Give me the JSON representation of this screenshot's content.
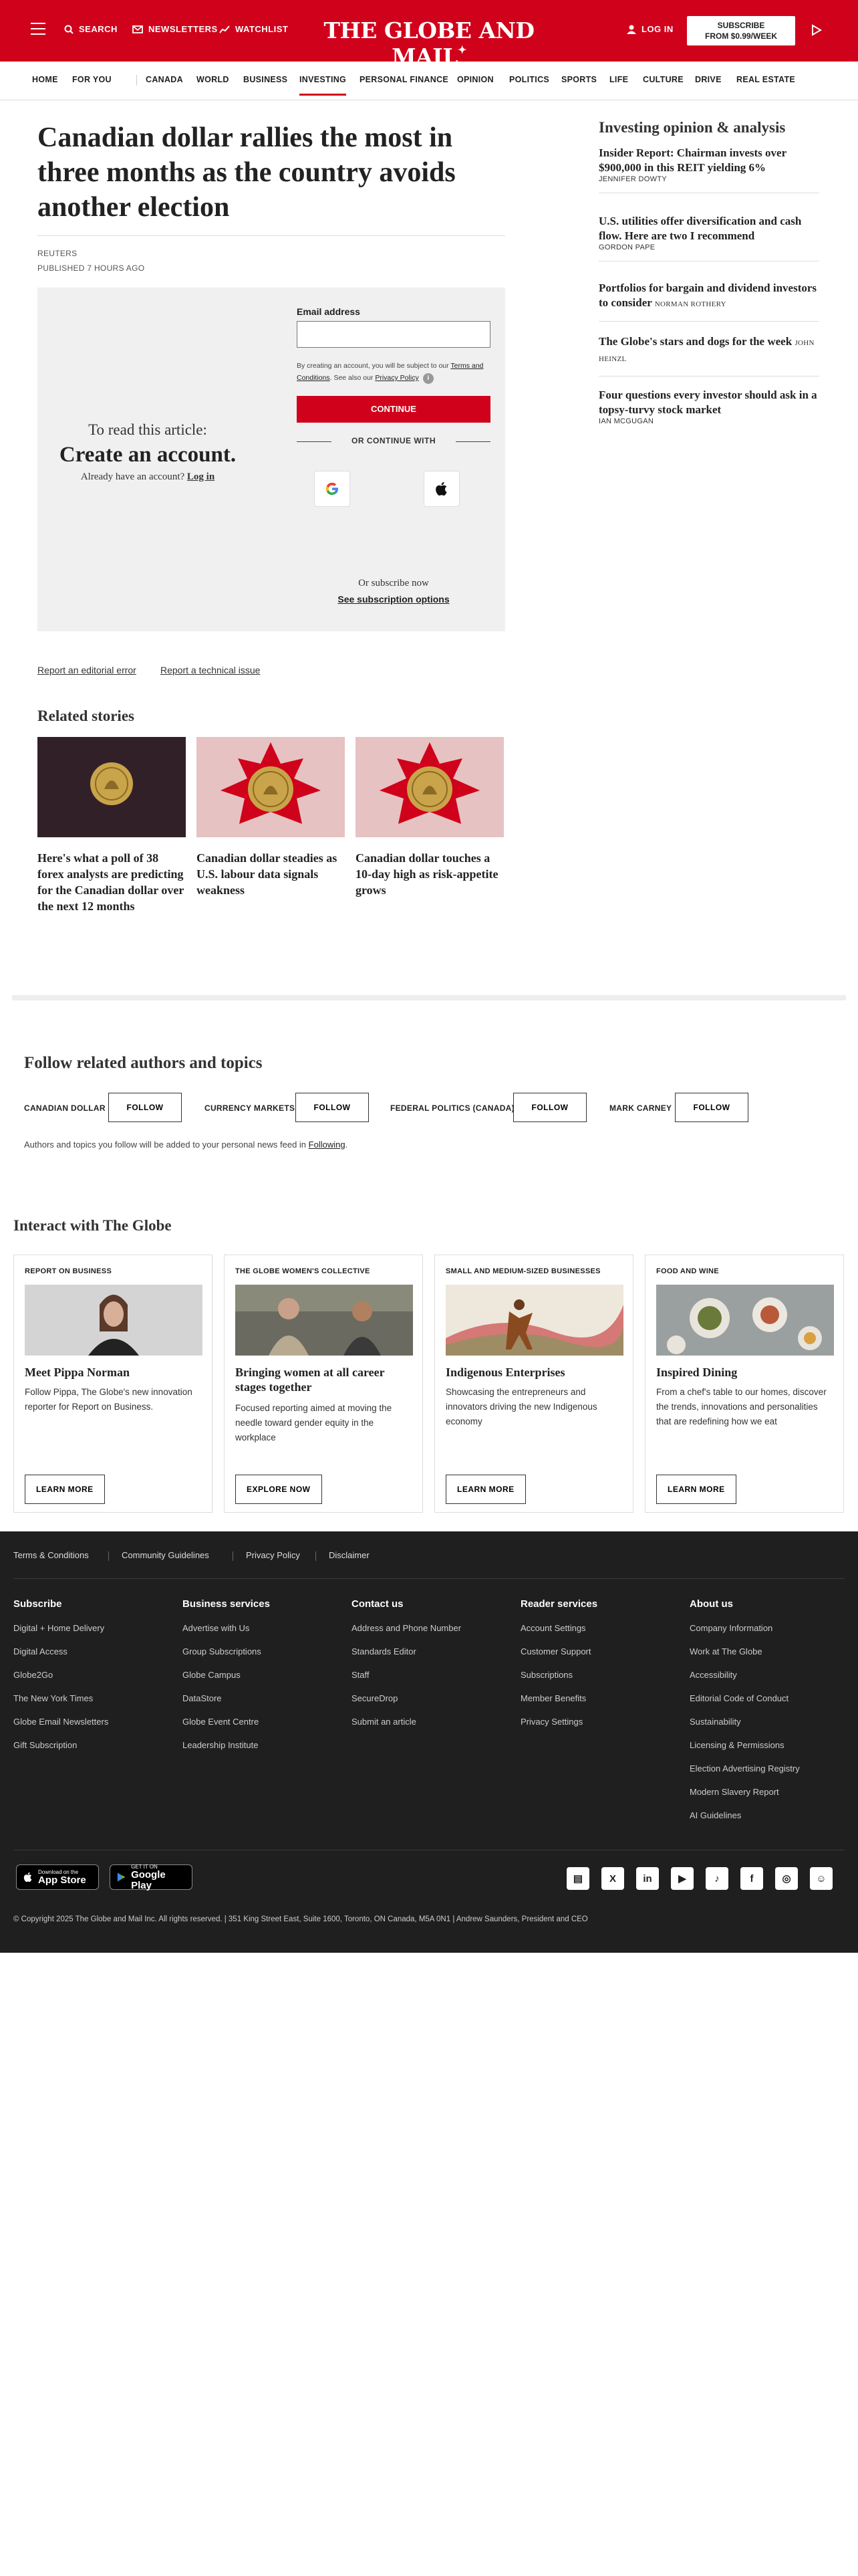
{
  "header": {
    "search_label": "SEARCH",
    "newsletters_label": "NEWSLETTERS",
    "watchlist_label": "WATCHLIST",
    "logo": "THE GLOBE AND MAIL",
    "login_label": "LOG IN",
    "subscribe_line1": "SUBSCRIBE",
    "subscribe_line2": "FROM $0.99/WEEK",
    "brand_color": "#d0021b"
  },
  "nav": {
    "items": [
      "HOME",
      "FOR YOU",
      "CANADA",
      "WORLD",
      "BUSINESS",
      "INVESTING",
      "PERSONAL FINANCE",
      "OPINION",
      "POLITICS",
      "SPORTS",
      "LIFE",
      "CULTURE",
      "DRIVE",
      "REAL ESTATE"
    ],
    "active": "INVESTING"
  },
  "article": {
    "headline": "Canadian dollar rallies the most in three months as the country avoids another election",
    "byline": "REUTERS",
    "published": "PUBLISHED 7 HOURS AGO"
  },
  "paywall": {
    "read_line": "To read this article:",
    "create_account": "Create an account.",
    "already": "Already have an account?",
    "login_link": "Log in",
    "email_label": "Email address",
    "email_value": "",
    "terms_pre": "By creating an account, you will be subject to our ",
    "terms_link": "Terms and Conditions",
    "terms_mid": ". See also our ",
    "privacy_link": "Privacy Policy",
    "continue_label": "CONTINUE",
    "or_continue": "OR CONTINUE WITH",
    "google_icon": "google-icon",
    "apple_icon": "apple-icon",
    "or_subscribe": "Or subscribe now",
    "subscription_options": "See subscription options"
  },
  "report": {
    "editorial": "Report an editorial error",
    "technical": "Report a technical issue"
  },
  "related": {
    "title": "Related stories",
    "items": [
      {
        "title": "Here's what a poll of 38 forex analysts are predicting for the Canadian dollar over the next 12 months"
      },
      {
        "title": "Canadian dollar steadies as U.S. labour data signals weakness"
      },
      {
        "title": "Canadian dollar touches a 10-day high as risk-appetite grows"
      }
    ]
  },
  "sidebar": {
    "title": "Investing opinion & analysis",
    "items": [
      {
        "title": "Insider Report: Chairman invests over $900,000 in this REIT yielding 6%",
        "author": "JENNIFER DOWTY"
      },
      {
        "title": "U.S. utilities offer diversification and cash flow. Here are two I recommend",
        "author": "GORDON PAPE"
      },
      {
        "title": "Portfolios for bargain and dividend investors to consider",
        "author": "NORMAN ROTHERY"
      },
      {
        "title": "The Globe's stars and dogs for the week",
        "author": "JOHN HEINZL"
      },
      {
        "title": "Four questions every investor should ask in a topsy-turvy stock market",
        "author": "IAN MCGUGAN"
      }
    ]
  },
  "follow": {
    "title": "Follow related authors and topics",
    "button_label": "FOLLOW",
    "topics": [
      "CANADIAN DOLLAR",
      "CURRENCY MARKETS",
      "FEDERAL POLITICS (CANADA)",
      "MARK CARNEY"
    ],
    "note_pre": "Authors and topics you follow will be added to your personal news feed in ",
    "note_link": "Following",
    "note_post": "."
  },
  "interact": {
    "title": "Interact with The Globe",
    "cards": [
      {
        "kicker": "REPORT ON BUSINESS",
        "title": "Meet Pippa Norman",
        "desc": "Follow Pippa, The Globe's new innovation reporter for Report on Business.",
        "button": "LEARN MORE"
      },
      {
        "kicker": "THE GLOBE WOMEN'S COLLECTIVE",
        "title": "Bringing women at all career stages together",
        "desc": "Focused reporting aimed at moving the needle toward gender equity in the workplace",
        "button": "EXPLORE NOW"
      },
      {
        "kicker": "SMALL AND MEDIUM-SIZED BUSINESSES",
        "title": "Indigenous Enterprises",
        "desc": "Showcasing the entrepreneurs and innovators driving the new Indigenous economy",
        "button": "LEARN MORE"
      },
      {
        "kicker": "FOOD AND WINE",
        "title": "Inspired Dining",
        "desc": "From a chef's table to our homes, discover the trends, innovations and personalities that are redefining how we eat",
        "button": "LEARN MORE"
      }
    ]
  },
  "footer": {
    "top_links": [
      "Terms & Conditions",
      "Community Guidelines",
      "Privacy Policy",
      "Disclaimer"
    ],
    "columns": [
      {
        "heading": "Subscribe",
        "links": [
          "Digital + Home Delivery",
          "Digital Access",
          "Globe2Go",
          "The New York Times",
          "Globe Email Newsletters",
          "Gift Subscription"
        ]
      },
      {
        "heading": "Business services",
        "links": [
          "Advertise with Us",
          "Group Subscriptions",
          "Globe Campus",
          "DataStore",
          "Globe Event Centre",
          "Leadership Institute"
        ]
      },
      {
        "heading": "Contact us",
        "links": [
          "Address and Phone Number",
          "Standards Editor",
          "Staff",
          "SecureDrop",
          "Submit an article"
        ]
      },
      {
        "heading": "Reader services",
        "links": [
          "Account Settings",
          "Customer Support",
          "Subscriptions",
          "Member Benefits",
          "Privacy Settings"
        ]
      },
      {
        "heading": "About us",
        "links": [
          "Company Information",
          "Work at The Globe",
          "Accessibility",
          "Editorial Code of Conduct",
          "Sustainability",
          "Licensing & Permissions",
          "Election Advertising Registry",
          "Modern Slavery Report",
          "AI Guidelines"
        ]
      }
    ],
    "appstore_small": "Download on the",
    "appstore_big": "App Store",
    "googleplay_small": "GET IT ON",
    "googleplay_big": "Google Play",
    "social_icons": [
      "store-icon",
      "x-icon",
      "linkedin-icon",
      "youtube-icon",
      "tiktok-icon",
      "facebook-icon",
      "instagram-icon",
      "snapchat-icon"
    ],
    "copyright": "© Copyright 2025 The Globe and Mail Inc. All rights reserved.  |  351 King Street East, Suite 1600, Toronto, ON Canada, M5A 0N1  |  Andrew Saunders, President and CEO"
  }
}
